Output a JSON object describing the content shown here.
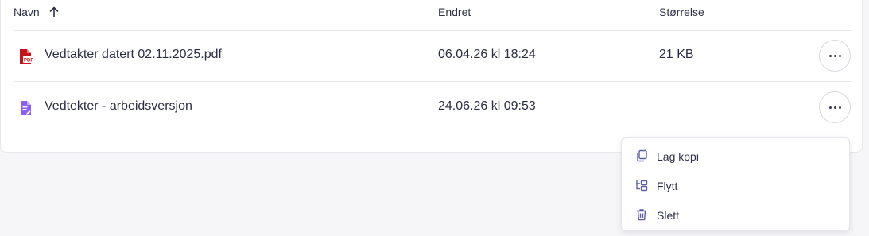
{
  "table": {
    "headers": {
      "name": "Navn",
      "modified": "Endret",
      "size": "Størrelse"
    },
    "sort_icon": "arrow-up-icon",
    "rows": [
      {
        "icon": "pdf-file-icon",
        "name": "Vedtakter datert 02.11.2025.pdf",
        "modified": "06.04.26 kl 18:24",
        "size": "21 KB"
      },
      {
        "icon": "document-file-icon",
        "name": "Vedtekter - arbeidsversjon",
        "modified": "24.06.26 kl 09:53",
        "size": ""
      }
    ]
  },
  "context_menu": {
    "items": [
      {
        "label": "Lag kopi",
        "icon": "copy-icon"
      },
      {
        "label": "Flytt",
        "icon": "move-icon"
      },
      {
        "label": "Slett",
        "icon": "trash-icon"
      }
    ]
  },
  "colors": {
    "pdf_icon": "#c6131b",
    "doc_icon": "#8b5cf6",
    "menu_icon": "#5b5fa8"
  }
}
